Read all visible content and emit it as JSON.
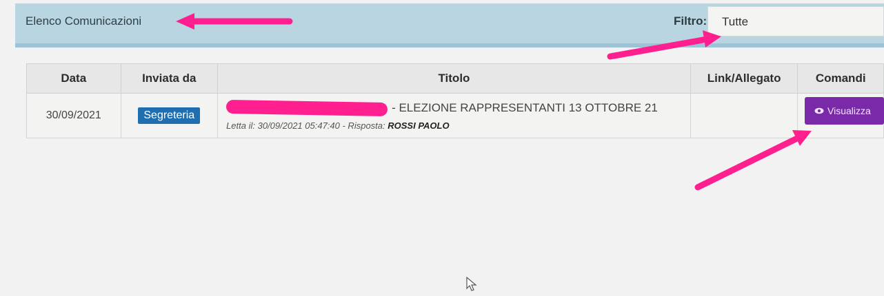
{
  "header": {
    "title": "Elenco Comunicazioni",
    "filter_label": "Filtro:",
    "filter_value": "Tutte"
  },
  "table": {
    "columns": [
      "Data",
      "Inviata da",
      "Titolo",
      "Link/Allegato",
      "Comandi"
    ],
    "rows": [
      {
        "date": "30/09/2021",
        "sender": "Segreteria",
        "title": "- ELEZIONE RAPPRESENTANTI 13 OTTOBRE 21",
        "read_label": "Letta il: 30/09/2021 05:47:40 - Risposta:",
        "reply_name": "ROSSI PAOLO",
        "link": "",
        "command": "Visualizza"
      }
    ]
  },
  "colors": {
    "header_bg": "#b9d5e2",
    "badge": "#1f6fb0",
    "view_button": "#7a2aa8",
    "annotation_arrow": "#ff1f8e"
  },
  "icons": {
    "view": "eye-icon",
    "cursor": "mouse-pointer-icon"
  }
}
